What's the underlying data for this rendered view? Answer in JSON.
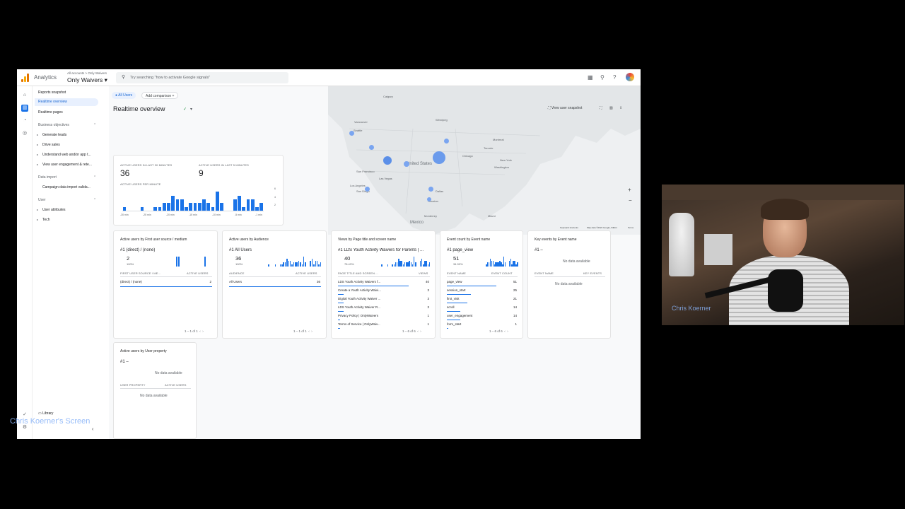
{
  "header": {
    "app_name": "Analytics",
    "account_path": "All accounts > Only Waivers",
    "property_name": "Only Waivers",
    "search_placeholder": "Try searching \"how to activate Google signals\""
  },
  "sidebar": {
    "items": [
      "Reports snapshot",
      "Realtime overview",
      "Realtime pages"
    ],
    "sections": [
      {
        "label": "Business objectives",
        "items": [
          "Generate leads",
          "Drive sales",
          "Understand web and/or app t...",
          "View user engagement & rete..."
        ]
      },
      {
        "label": "Data import",
        "items": [
          "Campaign data import valida..."
        ]
      },
      {
        "label": "User",
        "items": [
          "User attributes",
          "Tech"
        ]
      }
    ],
    "library": "Library"
  },
  "filters": {
    "all_users": "All Users",
    "add_comparison": "Add comparison"
  },
  "page_title": "Realtime overview",
  "map": {
    "view_snapshot": "View user snapshot",
    "country_label": "United States",
    "mexico_label": "Mexico",
    "footer": [
      "Keyboard shortcuts",
      "Map data ©2024 Google, INEGI",
      "Terms"
    ],
    "cities": [
      "Calgary",
      "Vancouver",
      "Winnipeg",
      "Seattle",
      "Montreal",
      "Toronto",
      "Chicago",
      "New York",
      "Washington",
      "San Francisco",
      "Las Vegas",
      "Los Angeles",
      "San Diego",
      "Dallas",
      "Houston",
      "Miami",
      "Monterrey"
    ]
  },
  "summary": {
    "label_30": "ACTIVE USERS IN LAST 30 MINUTES",
    "value_30": "36",
    "label_5": "ACTIVE USERS IN LAST 5 MINUTES",
    "value_5": "9",
    "per_minute_label": "ACTIVE USERS PER MINUTE",
    "y_ticks": [
      "6",
      "4",
      "2"
    ],
    "x_ticks": [
      "-30 min",
      "-25 min",
      "-20 min",
      "-15 min",
      "-10 min",
      "-5 min",
      "-1 min"
    ]
  },
  "chart_data": {
    "type": "bar",
    "title": "ACTIVE USERS PER MINUTE",
    "ylim": [
      0,
      6
    ],
    "values": [
      1,
      0,
      0,
      0,
      1,
      0,
      0,
      1,
      1,
      2,
      2,
      4,
      3,
      3,
      1,
      2,
      2,
      2,
      3,
      2,
      1,
      5,
      2,
      0,
      0,
      3,
      4,
      1,
      3,
      3,
      1,
      2
    ]
  },
  "cards": [
    {
      "title": "Active users by First user source / medium",
      "rank": "#1 (direct) / (none)",
      "value": "2",
      "pct": "100%",
      "col1": "FIRST USER SOURCE / ME...",
      "col2": "ACTIVE USERS",
      "rows": [
        {
          "name": "(direct) / (none)",
          "val": "2"
        }
      ],
      "pager": "1 – 1 of 1"
    },
    {
      "title": "Active users by Audience",
      "rank": "#1 All Users",
      "value": "36",
      "pct": "100%",
      "col1": "AUDIENCE",
      "col2": "ACTIVE USERS",
      "rows": [
        {
          "name": "All Users",
          "val": "36"
        }
      ],
      "pager": "1 – 1 of 1"
    },
    {
      "title": "Views by Page title and screen name",
      "rank": "#1 LDS Youth Activity Waivers for Parents | ...",
      "value": "40",
      "pct": "78.43%",
      "col1": "PAGE TITLE AND SCREEN ...",
      "col2": "VIEWS",
      "rows": [
        {
          "name": "LDS Youth Activity Waivers f...",
          "val": "40"
        },
        {
          "name": "Create a Youth Activity Waivi...",
          "val": "3"
        },
        {
          "name": "Digital Youth Activity Waiver ...",
          "val": "3"
        },
        {
          "name": "LDS Youth Activity Waiver R...",
          "val": "3"
        },
        {
          "name": "Privacy Policy | OnlyWaivers",
          "val": "1"
        },
        {
          "name": "Terms of Service | OnlyWaiv...",
          "val": "1"
        }
      ],
      "pager": "1 – 6 of 6"
    },
    {
      "title": "Event count by Event name",
      "rank": "#1 page_view",
      "value": "51",
      "pct": "34.90%",
      "col1": "EVENT NAME",
      "col2": "EVENT COUNT",
      "rows": [
        {
          "name": "page_view",
          "val": "51"
        },
        {
          "name": "session_start",
          "val": "25"
        },
        {
          "name": "first_visit",
          "val": "21"
        },
        {
          "name": "scroll",
          "val": "14"
        },
        {
          "name": "user_engagement",
          "val": "14"
        },
        {
          "name": "form_start",
          "val": "1"
        }
      ],
      "pager": "1 – 6 of 6"
    },
    {
      "title": "Key events by Event name",
      "rank": "#1 –",
      "no_data": "No data available",
      "col1": "EVENT NAME",
      "col2": "KEY EVENTS",
      "no_data_table": "No data available"
    },
    {
      "title": "Active users by User property",
      "rank": "#1 –",
      "no_data": "No data available",
      "col1": "USER PROPERTY",
      "col2": "ACTIVE USERS",
      "no_data_table": "No data available"
    }
  ],
  "webcam": {
    "name": "Chris Koerner"
  },
  "screen_label": "Chris Koerner's Screen",
  "colors": {
    "accent": "#1a73e8",
    "active_bg": "#e8f0fe"
  }
}
